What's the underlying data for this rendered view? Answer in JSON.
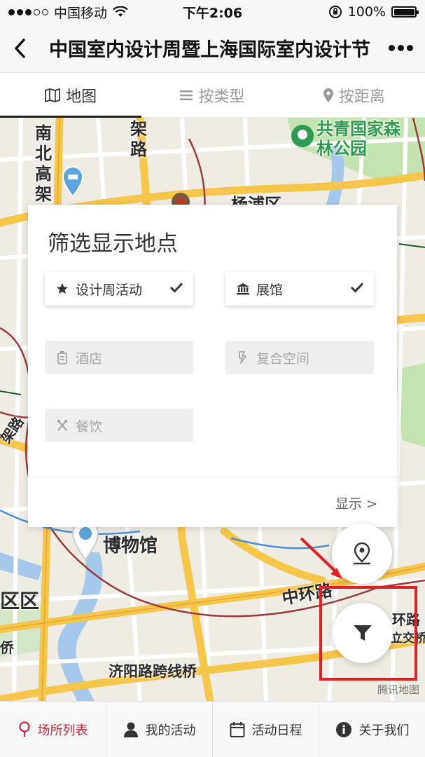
{
  "status_bar": {
    "carrier": "中国移动",
    "time": "下午2:06",
    "battery": "100%"
  },
  "nav": {
    "title": "中国室内设计周暨上海国际室内设计节"
  },
  "tabs": [
    {
      "label": "地图",
      "icon": "map-icon",
      "active": true
    },
    {
      "label": "按类型",
      "icon": "list-icon",
      "active": false
    },
    {
      "label": "按距离",
      "icon": "location-pin-icon",
      "active": false
    }
  ],
  "map": {
    "labels": {
      "park": "共青国家森林公园",
      "road_north_south": "南北高架",
      "road_frame": "架路",
      "district_top": "杨浦区",
      "museum": "博物馆",
      "middle_ring": "中环路",
      "ring": "环路",
      "district_left": "区区",
      "bridge": "济阳路跨线桥",
      "left_road": "架路",
      "bottom_left": "侨",
      "right_small": "立交桥"
    },
    "watermark": "腾讯地图",
    "colors": {
      "road_major": "#f6c64a",
      "road_minor": "#ffffff",
      "water": "#a6c8ea",
      "park": "#b9dfa5",
      "rail": "#9a3b3b"
    }
  },
  "filter_panel": {
    "title": "筛选显示地点",
    "options": [
      {
        "label": "设计周活动",
        "icon": "star-icon",
        "selected": true
      },
      {
        "label": "展馆",
        "icon": "museum-icon",
        "selected": true
      },
      {
        "label": "酒店",
        "icon": "hotel-icon",
        "selected": false
      },
      {
        "label": "复合空间",
        "icon": "space-icon",
        "selected": false
      },
      {
        "label": "餐饮",
        "icon": "utensils-icon",
        "selected": false
      }
    ],
    "show_button": "显示 >"
  },
  "bottom_bar": [
    {
      "label": "场所列表",
      "icon": "location-pin-icon",
      "active": true
    },
    {
      "label": "我的活动",
      "icon": "user-icon",
      "active": false
    },
    {
      "label": "活动日程",
      "icon": "calendar-icon",
      "active": false
    },
    {
      "label": "关于我们",
      "icon": "info-icon",
      "active": false
    }
  ]
}
